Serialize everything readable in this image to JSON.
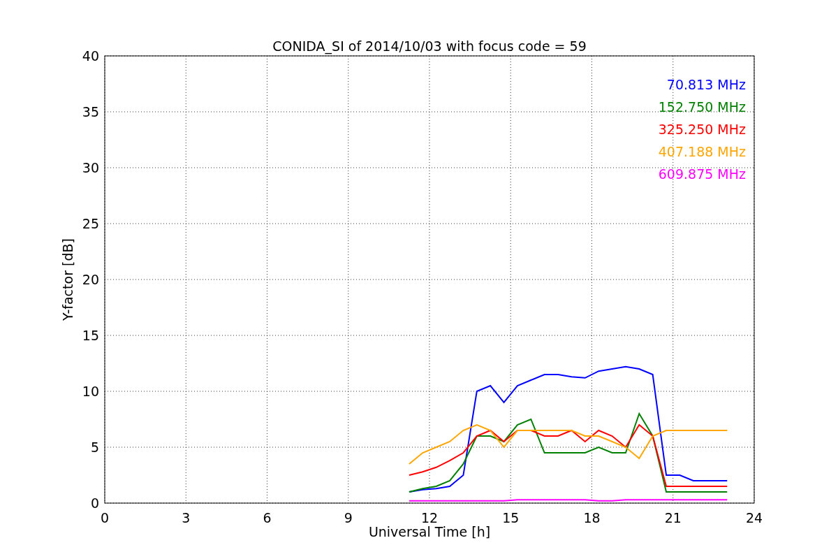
{
  "chart_data": {
    "type": "line",
    "title": "CONIDA_SI of 2014/10/03 with focus code = 59",
    "xlabel": "Universal Time [h]",
    "ylabel": "Y-factor [dB]",
    "x": [
      11.25,
      11.75,
      12.25,
      12.75,
      13.25,
      13.75,
      14.25,
      14.75,
      15.25,
      15.75,
      16.25,
      16.75,
      17.25,
      17.75,
      18.25,
      18.75,
      19.25,
      19.75,
      20.25,
      20.75,
      21.25,
      21.75,
      22.25,
      22.75,
      23
    ],
    "series": [
      {
        "name": "70.813 MHz",
        "color": "#0000ff",
        "values": [
          1,
          1.2,
          1.3,
          1.5,
          2.5,
          10,
          10.5,
          9,
          10.5,
          11,
          11.5,
          11.5,
          11.3,
          11.2,
          11.8,
          12,
          12.2,
          12,
          11.5,
          2.5,
          2.5,
          2,
          2,
          2,
          2
        ]
      },
      {
        "name": "152.750 MHz",
        "color": "#008000",
        "values": [
          1,
          1.3,
          1.5,
          2,
          3.5,
          6,
          6,
          5.5,
          7,
          7.5,
          4.5,
          4.5,
          4.5,
          4.5,
          5,
          4.5,
          4.5,
          8,
          6,
          1,
          1,
          1,
          1,
          1,
          1
        ]
      },
      {
        "name": "325.250 MHz",
        "color": "#ff0000",
        "values": [
          2.5,
          2.8,
          3.2,
          3.8,
          4.5,
          6,
          6.5,
          5.5,
          6.5,
          6.5,
          6,
          6,
          6.5,
          5.5,
          6.5,
          6,
          5,
          7,
          6,
          1.5,
          1.5,
          1.5,
          1.5,
          1.5,
          1.5
        ]
      },
      {
        "name": "407.188 MHz",
        "color": "#ffa500",
        "values": [
          3.5,
          4.5,
          5,
          5.5,
          6.5,
          7,
          6.5,
          5,
          6.5,
          6.5,
          6.5,
          6.5,
          6.5,
          6,
          6,
          5.5,
          5,
          4,
          6,
          6.5,
          6.5,
          6.5,
          6.5,
          6.5,
          6.5
        ]
      },
      {
        "name": "609.875 MHz",
        "color": "#ff00ff",
        "values": [
          0.2,
          0.2,
          0.2,
          0.2,
          0.2,
          0.2,
          0.2,
          0.2,
          0.3,
          0.3,
          0.3,
          0.3,
          0.3,
          0.3,
          0.2,
          0.2,
          0.3,
          0.3,
          0.3,
          0.3,
          0.3,
          0.3,
          0.3,
          0.3,
          0.3
        ]
      }
    ],
    "grid": true,
    "xlim": [
      0,
      24
    ],
    "ylim": [
      0,
      40
    ],
    "xticks": [
      0,
      3,
      6,
      9,
      12,
      15,
      18,
      21,
      24
    ],
    "yticks": [
      0,
      5,
      10,
      15,
      20,
      25,
      30,
      35,
      40
    ]
  }
}
